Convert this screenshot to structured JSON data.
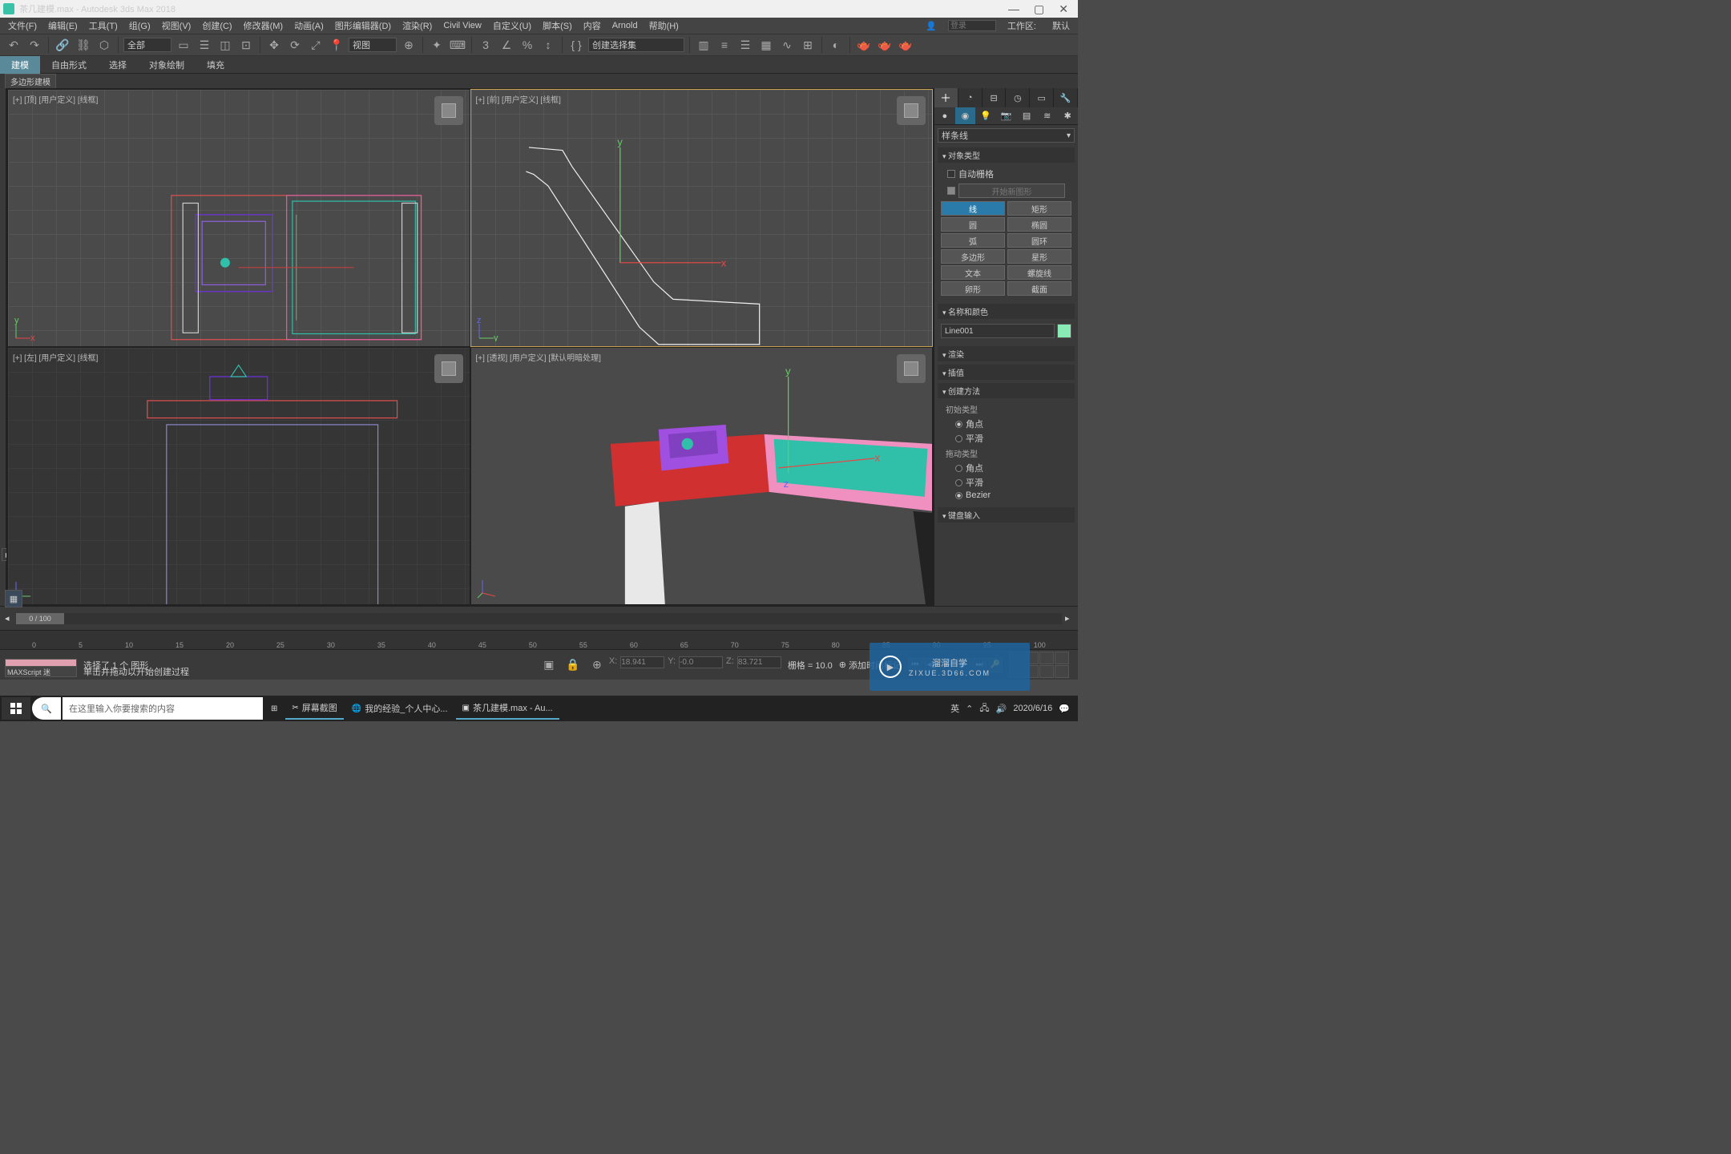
{
  "title": "茶几建模.max - Autodesk 3ds Max 2018",
  "menu": [
    "文件(F)",
    "编辑(E)",
    "工具(T)",
    "组(G)",
    "视图(V)",
    "创建(C)",
    "修改器(M)",
    "动画(A)",
    "图形编辑器(D)",
    "渲染(R)",
    "Civil View",
    "自定义(U)",
    "脚本(S)",
    "内容",
    "Arnold",
    "帮助(H)"
  ],
  "login_placeholder": "登录",
  "workspace_label": "工作区:",
  "workspace_value": "默认",
  "toolbar_sel1": "全部",
  "toolbar_sel2": "视图",
  "toolbar_sel3": "创建选择集",
  "ribbon": {
    "tabs": [
      "建模",
      "自由形式",
      "选择",
      "对象绘制",
      "填充"
    ]
  },
  "subbar": "多边形建模",
  "viewports": {
    "top": "[+] [顶] [用户定义] [线框]",
    "front": "[+] [前] [用户定义] [线框]",
    "left": "[+] [左] [用户定义] [线框]",
    "persp": "[+] [透视] [用户定义] [默认明暗处理]"
  },
  "cmd": {
    "dropdown": "样条线",
    "rollout_objtype": "对象类型",
    "autogrid": "自动栅格",
    "startnew": "开始新图形",
    "buttons": [
      [
        "线",
        "矩形"
      ],
      [
        "圆",
        "椭圆"
      ],
      [
        "弧",
        "圆环"
      ],
      [
        "多边形",
        "星形"
      ],
      [
        "文本",
        "螺旋线"
      ],
      [
        "卵形",
        "截面"
      ]
    ],
    "rollout_name": "名称和颜色",
    "name_value": "Line001",
    "rollout_render": "渲染",
    "rollout_interp": "插值",
    "rollout_create": "创建方法",
    "init_type": "初始类型",
    "drag_type": "拖动类型",
    "opt_corner": "角点",
    "opt_smooth": "平滑",
    "opt_bezier": "Bezier",
    "rollout_keyboard": "键盘输入"
  },
  "timeline": {
    "pos": "0 / 100",
    "ticks": [
      "0",
      "5",
      "10",
      "15",
      "20",
      "25",
      "30",
      "35",
      "40",
      "45",
      "50",
      "55",
      "60",
      "65",
      "70",
      "75",
      "80",
      "85",
      "90",
      "95",
      "100"
    ]
  },
  "status": {
    "selected": "选择了 1 个 图形",
    "prompt": "单击并拖动以开始创建过程",
    "maxscript": "MAXScript 迷",
    "x_label": "X:",
    "x": "18.941",
    "y_label": "Y:",
    "y": "-0.0",
    "z_label": "Z:",
    "z": "83.721",
    "grid_label": "栅格 = ",
    "grid": "10.0",
    "addtime": "添加时间标记"
  },
  "taskbar": {
    "search_placeholder": "在这里输入你要搜索的内容",
    "items": [
      "屏幕截图",
      "我的经验_个人中心...",
      "茶几建模.max - Au..."
    ],
    "ime": "英",
    "date": "2020/6/16"
  },
  "watermark": {
    "main": "溜溜自学",
    "sub": "ZIXUE.3D66.COM"
  }
}
